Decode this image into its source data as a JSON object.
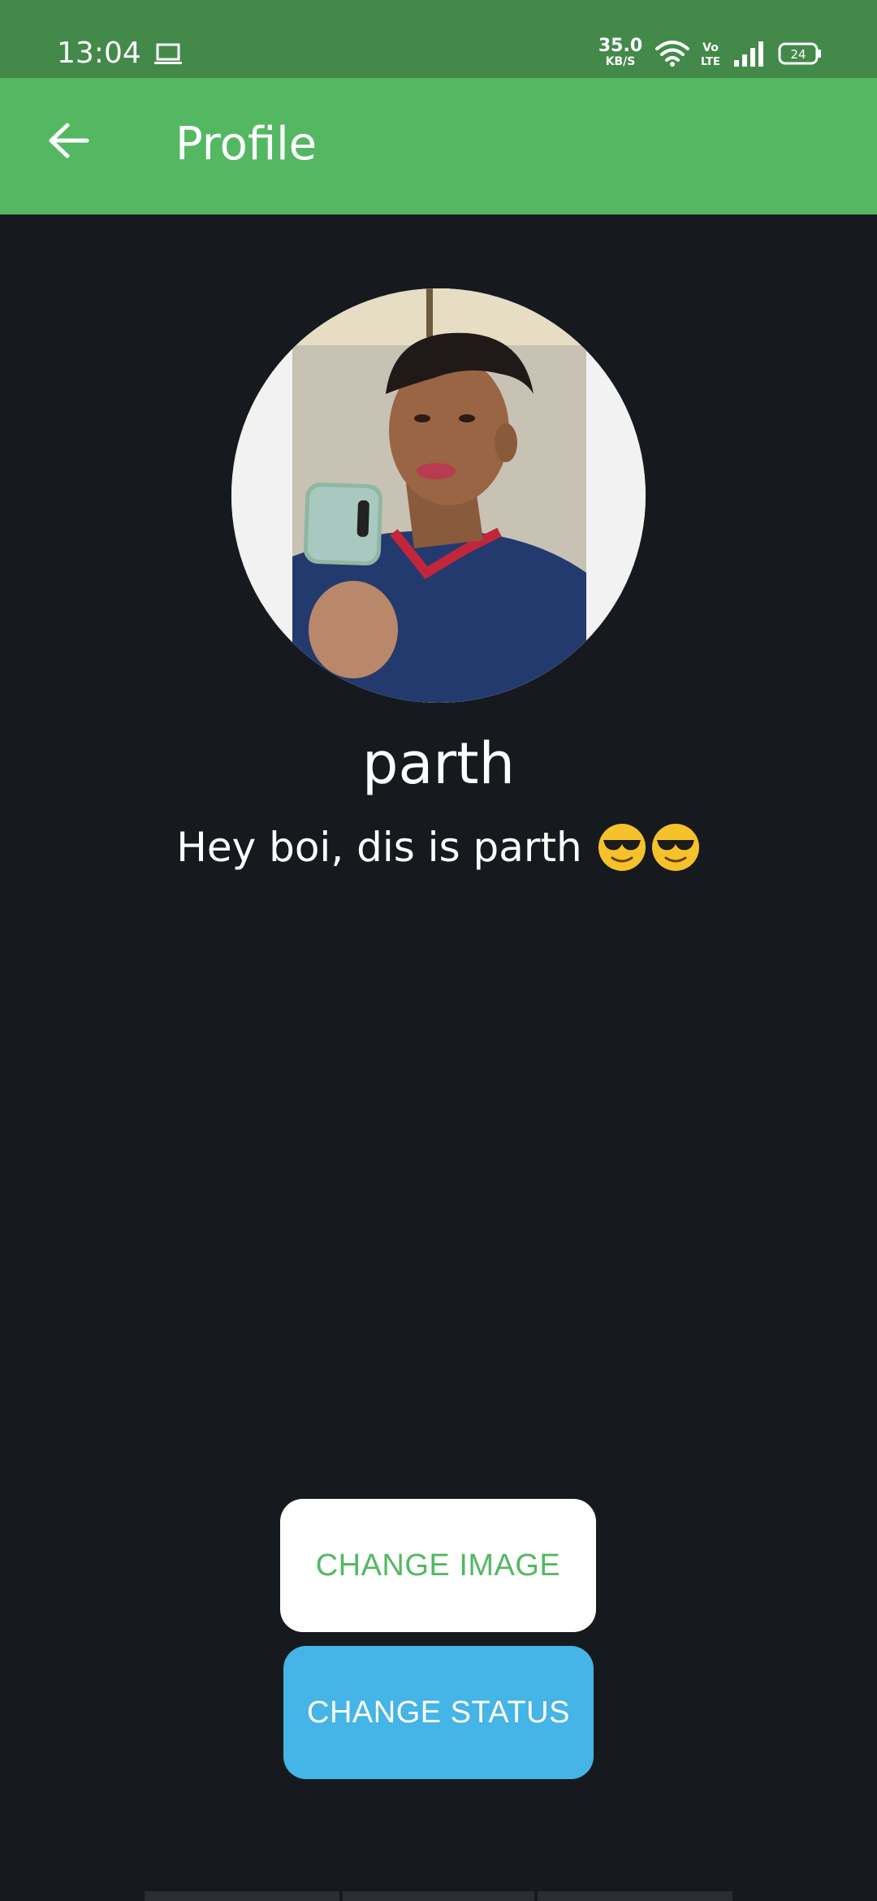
{
  "status_bar": {
    "time": "13:04",
    "network_speed_value": "35.0",
    "network_speed_unit": "KB/S",
    "battery_level": "24",
    "icons": [
      "laptop-icon",
      "wifi-icon",
      "volte-icon",
      "signal-icon",
      "battery-icon"
    ]
  },
  "app_bar": {
    "title": "Profile",
    "back_icon": "arrow-left-icon"
  },
  "profile": {
    "name": "parth",
    "status_text": "Hey boi, dis is parth",
    "status_emojis": [
      "smiling-face-with-sunglasses",
      "smiling-face-with-sunglasses"
    ]
  },
  "actions": {
    "change_image_label": "CHANGE IMAGE",
    "change_status_label": "CHANGE STATUS"
  },
  "colors": {
    "status_bar": "#43894a",
    "app_bar": "#54b862",
    "background": "#161a1f",
    "accent_blue": "#45b4e6"
  }
}
